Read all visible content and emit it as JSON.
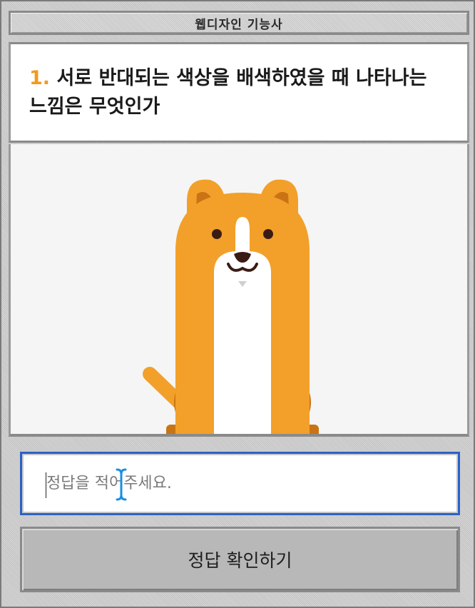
{
  "header": {
    "title": "웹디자인 기능사"
  },
  "question": {
    "number": "1.",
    "text": "서로 반대되는 색상을 배색하였을 때 나타나는 느낌은 무엇인가"
  },
  "answer": {
    "placeholder": "정답을 적어주세요.",
    "value": ""
  },
  "submit": {
    "label": "정답 확인하기"
  },
  "colors": {
    "accent": "#f29a1e",
    "dog_fur": "#f2a02a",
    "dog_dark": "#c87414",
    "input_focus": "#2a62c8",
    "button_bg": "#b8b8b8"
  },
  "icons": {
    "illustration": "dog-illustration",
    "cursor": "text-cursor-icon"
  }
}
